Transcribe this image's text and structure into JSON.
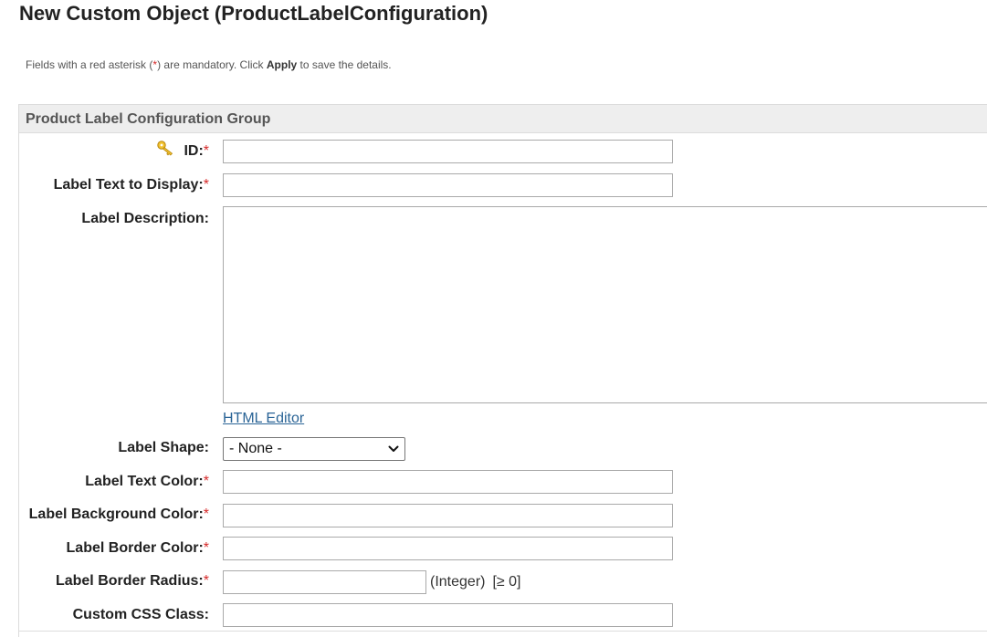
{
  "page": {
    "title": "New Custom Object (ProductLabelConfiguration)",
    "info": {
      "prefix": "Fields with a red asterisk (",
      "asterisk": "*",
      "middle": ") are mandatory. Click ",
      "apply": "Apply",
      "suffix": " to save the details."
    }
  },
  "group": {
    "title": "Product Label Configuration Group"
  },
  "fields": {
    "id": {
      "label": "ID:",
      "required": "*",
      "icon": "key-icon",
      "value": ""
    },
    "label_text": {
      "label": "Label Text to Display:",
      "required": "*",
      "value": ""
    },
    "label_description": {
      "label": "Label Description:",
      "value": ""
    },
    "html_editor_link": "HTML Editor",
    "label_shape": {
      "label": "Label Shape:",
      "selected": "- None -"
    },
    "label_text_color": {
      "label": "Label Text Color:",
      "required": "*",
      "value": ""
    },
    "label_background_color": {
      "label": "Label Background Color:",
      "required": "*",
      "value": ""
    },
    "label_border_color": {
      "label": "Label Border Color:",
      "required": "*",
      "value": ""
    },
    "label_border_radius": {
      "label": "Label Border Radius:",
      "required": "*",
      "value": "",
      "type_hint": "(Integer)",
      "range_hint": "[≥ 0]"
    },
    "custom_css_class": {
      "label": "Custom CSS Class:",
      "value": ""
    }
  },
  "colors": {
    "required_star": "#d62a2a",
    "link": "#2a6496",
    "group_header_bg": "#eeeeee"
  }
}
